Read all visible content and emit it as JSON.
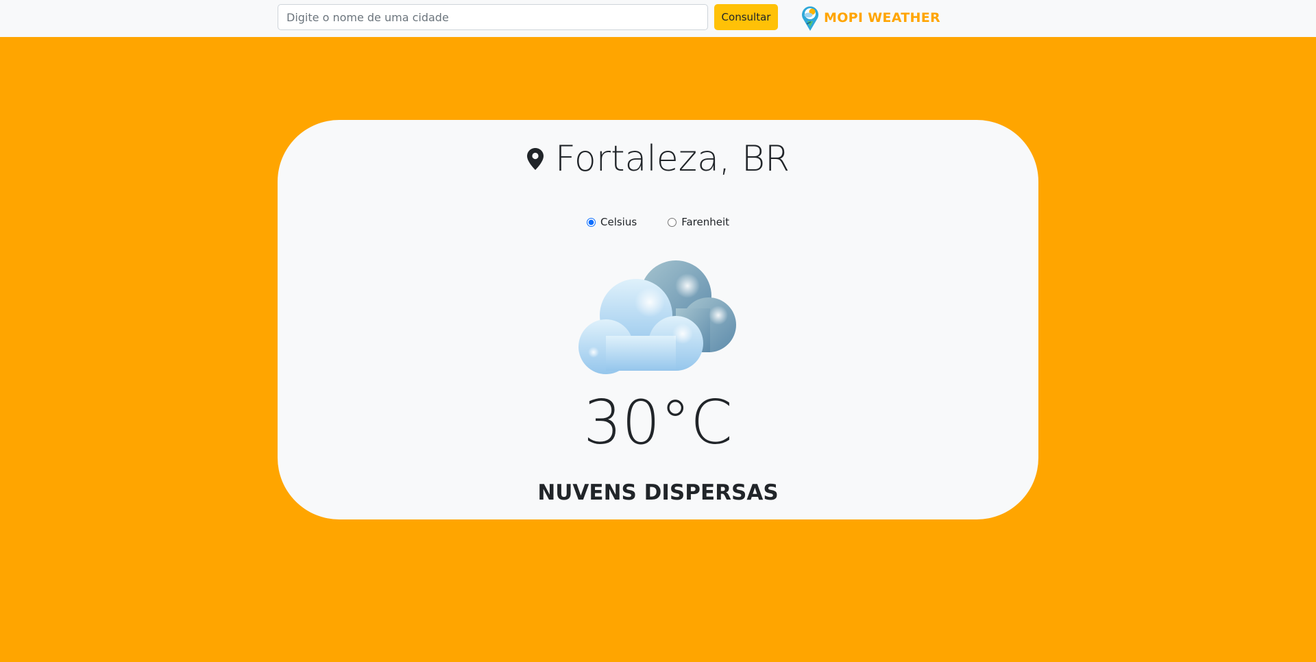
{
  "header": {
    "search_placeholder": "Digite o nome de uma cidade",
    "search_value": "",
    "search_button_label": "Consultar",
    "brand_name": "MOPI WEATHER"
  },
  "weather": {
    "city": "Fortaleza, BR",
    "units": [
      {
        "label": "Celsius",
        "selected": true
      },
      {
        "label": "Farenheit",
        "selected": false
      }
    ],
    "icon": "scattered-clouds-icon",
    "temperature": "30°C",
    "description": "NUVENS DISPERSAS"
  },
  "colors": {
    "page_background": "#ffa500",
    "card_background": "#f8f9fa",
    "button_background": "#ffc107",
    "brand_text": "#ffa500",
    "radio_accent": "#0d6efd"
  }
}
